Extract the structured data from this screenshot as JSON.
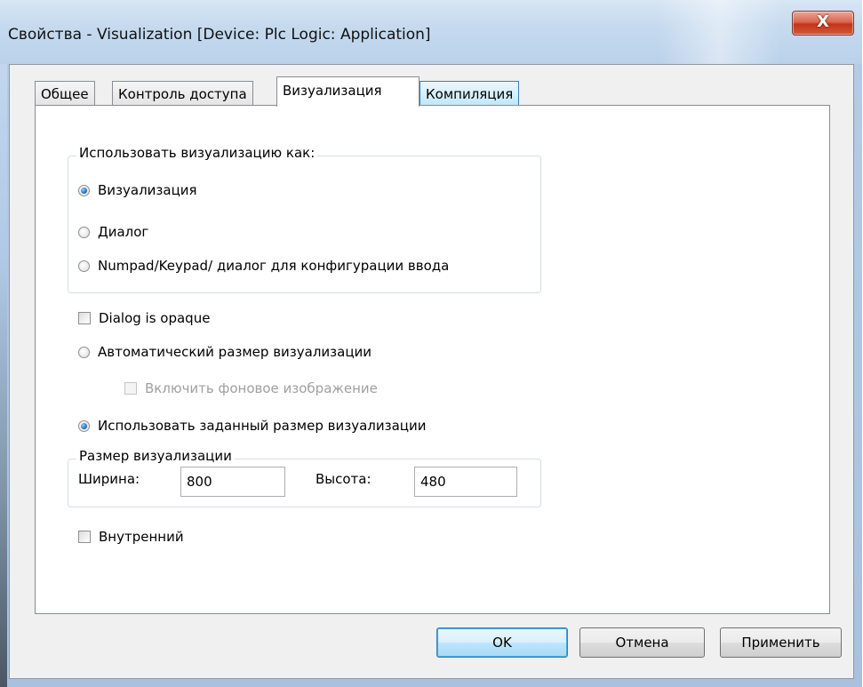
{
  "window": {
    "title": "Свойства - Visualization [Device: Plc Logic: Application]",
    "close_glyph": "X"
  },
  "tabs": [
    {
      "label": "Общее",
      "active": false
    },
    {
      "label": "Контроль доступа",
      "active": false
    },
    {
      "label": "Визуализация",
      "active": true
    },
    {
      "label": "Компиляция",
      "active": false
    }
  ],
  "use_as_group": {
    "caption": "Использовать визуализацию как:",
    "options": [
      {
        "label": "Визуализация",
        "checked": true
      },
      {
        "label": "Диалог",
        "checked": false
      },
      {
        "label": "Numpad/Keypad/ диалог для конфигурации ввода",
        "checked": false
      }
    ]
  },
  "options": {
    "dialog_opaque": {
      "label": "Dialog is opaque",
      "checked": false
    },
    "auto_size": {
      "label": "Автоматический размер визуализации",
      "checked": false
    },
    "background_image": {
      "label": "Включить фоновое изображение",
      "checked": false,
      "disabled": true
    },
    "fixed_size": {
      "label": "Использовать заданный размер визуализации",
      "checked": true
    },
    "internal": {
      "label": "Внутренний",
      "checked": false
    }
  },
  "size_group": {
    "caption": "Размер визуализации",
    "width_label": "Ширина:",
    "width_value": "800",
    "height_label": "Высота:",
    "height_value": "480"
  },
  "buttons": {
    "ok": "OK",
    "cancel": "Отмена",
    "apply": "Применить"
  },
  "colors": {
    "titlebar": "#c6daef",
    "close_button": "#c4341a",
    "dialog_bg": "#f0f0f0",
    "default_button": "#bee6fd"
  }
}
